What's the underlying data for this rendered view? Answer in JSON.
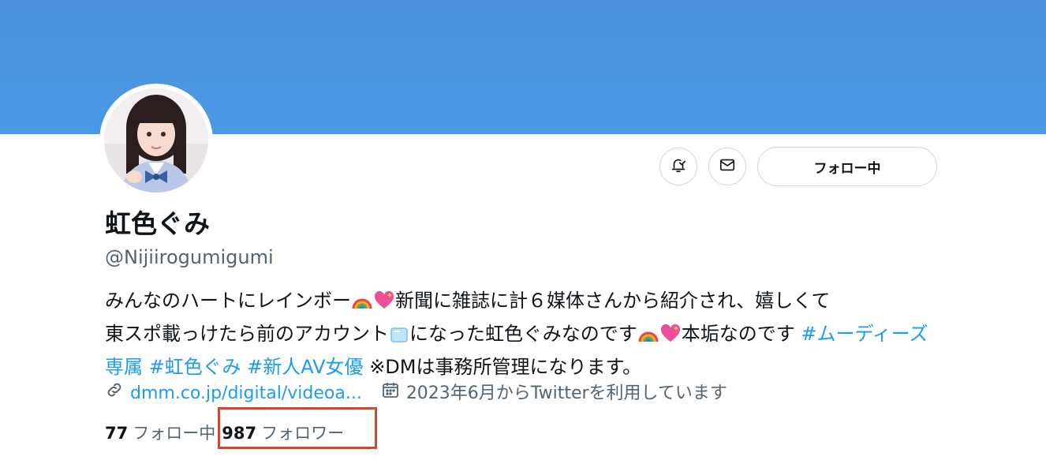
{
  "profile": {
    "display_name": "虹色ぐみ",
    "handle": "@Nijiirogumigumi",
    "follow_button_label": "フォロー中"
  },
  "bio": {
    "part1": "みんなのハートにレインボー",
    "part2": "新聞に雑誌に計６媒体さんから紹介され、嬉しくて",
    "part3": "東スポ載っけたら前のアカウント",
    "part4": "になった虹色ぐみなのです",
    "part5": "本垢なのです ",
    "hashtag1": "#ムーディーズ専属",
    "hashtag2": "#虹色ぐみ",
    "hashtag3": "#新人AV女優",
    "part6": "※DMは事務所管理になります。"
  },
  "meta": {
    "link_text": "dmm.co.jp/digital/videoa...",
    "joined_text": "2023年6月からTwitterを利用しています",
    "link_icon": "link-icon",
    "calendar_icon": "calendar-icon"
  },
  "stats": {
    "following_count": "77",
    "following_label": "フォロー中",
    "followers_count": "987",
    "followers_label": "フォロワー"
  },
  "colors": {
    "banner": "#4a99e6",
    "link": "#1d9bf0",
    "highlight_box": "#d04a2e"
  },
  "icons": {
    "notification": "bell-check-icon",
    "message": "mail-icon"
  }
}
